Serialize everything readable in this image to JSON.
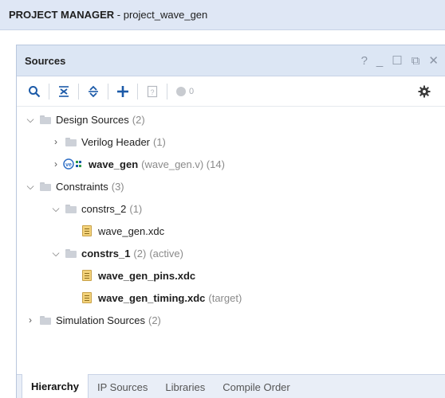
{
  "header": {
    "title_bold": "PROJECT MANAGER",
    "title_rest": " - project_wave_gen"
  },
  "panel": {
    "title": "Sources",
    "controls": {
      "help": "?",
      "minimize": "_",
      "maximize": "☐",
      "restore": "⧉",
      "close": "✕"
    }
  },
  "toolbar": {
    "status_count": "0"
  },
  "tree": {
    "design_sources": {
      "label": "Design Sources",
      "count": "(2)"
    },
    "verilog_header": {
      "label": "Verilog Header",
      "count": "(1)"
    },
    "wave_gen": {
      "label": "wave_gen",
      "detail": "(wave_gen.v) (14)"
    },
    "constraints": {
      "label": "Constraints",
      "count": "(3)"
    },
    "constrs_2": {
      "label": "constrs_2",
      "count": "(1)"
    },
    "wave_gen_xdc": {
      "label": "wave_gen.xdc"
    },
    "constrs_1": {
      "label": "constrs_1",
      "count": "(2)",
      "status": "(active)"
    },
    "wave_gen_pins": {
      "label": "wave_gen_pins.xdc"
    },
    "wave_gen_timing": {
      "label": "wave_gen_timing.xdc",
      "status": "(target)"
    },
    "simulation_sources": {
      "label": "Simulation Sources",
      "count": "(2)"
    }
  },
  "tabs": [
    "Hierarchy",
    "IP Sources",
    "Libraries",
    "Compile Order"
  ],
  "colors": {
    "header_bg": "#dfe7f5",
    "accent_blue": "#1c5aa8",
    "muted": "#8a8a8a"
  }
}
